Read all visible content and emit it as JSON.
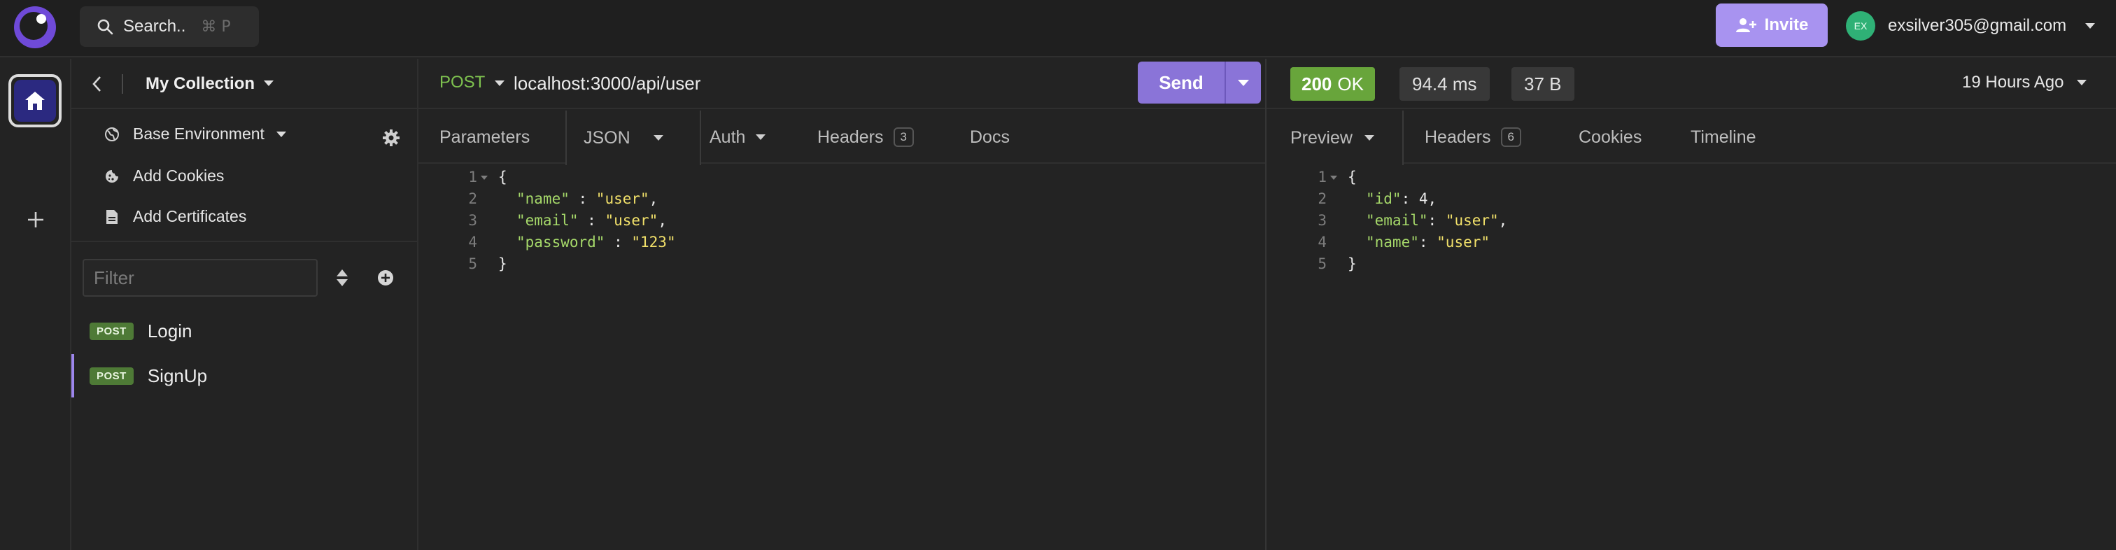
{
  "topbar": {
    "search_label": "Search..",
    "search_shortcut": "⌘ P",
    "invite_label": "Invite",
    "user_initials": "EX",
    "user_email": "exsilver305@gmail.com"
  },
  "sidebar": {
    "collection_title": "My Collection",
    "environment_label": "Base Environment",
    "add_cookies_label": "Add Cookies",
    "add_certificates_label": "Add Certificates",
    "filter_placeholder": "Filter",
    "requests": [
      {
        "method": "POST",
        "name": "Login"
      },
      {
        "method": "POST",
        "name": "SignUp"
      }
    ]
  },
  "request": {
    "method": "POST",
    "url": "localhost:3000/api/user",
    "send_label": "Send",
    "tabs": {
      "parameters": "Parameters",
      "json": "JSON",
      "auth": "Auth",
      "headers": "Headers",
      "headers_count": "3",
      "docs": "Docs"
    },
    "body_lines": {
      "l1": "{",
      "l2_key": "\"name\"",
      "l2_sep": " : ",
      "l2_val": "\"user\"",
      "l2_end": ",",
      "l3_key": "\"email\"",
      "l3_sep": " : ",
      "l3_val": "\"user\"",
      "l3_end": ",",
      "l4_key": "\"password\"",
      "l4_sep": " : ",
      "l4_val": "\"123\"",
      "l5": "}"
    }
  },
  "response": {
    "status_code": "200",
    "status_text": "OK",
    "time": "94.4 ms",
    "size": "37 B",
    "received": "19 Hours Ago",
    "tabs": {
      "preview": "Preview",
      "headers": "Headers",
      "headers_count": "6",
      "cookies": "Cookies",
      "timeline": "Timeline"
    },
    "body_lines": {
      "l1": "{",
      "l2_key": "\"id\"",
      "l2_sep": ": ",
      "l2_val": "4",
      "l2_end": ",",
      "l3_key": "\"email\"",
      "l3_sep": ": ",
      "l3_val": "\"user\"",
      "l3_end": ",",
      "l4_key": "\"name\"",
      "l4_sep": ": ",
      "l4_val": "\"user\"",
      "l5": "}"
    }
  },
  "line_numbers": [
    "1",
    "2",
    "3",
    "4",
    "5"
  ]
}
